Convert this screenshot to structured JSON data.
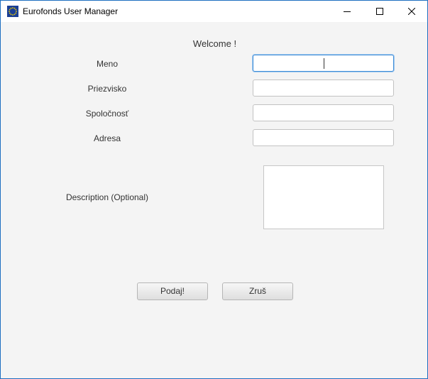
{
  "window": {
    "title": "Eurofonds User Manager",
    "icon": "eu-flag-icon",
    "controls": [
      "minimize-icon",
      "maximize-icon",
      "close-icon"
    ]
  },
  "form": {
    "welcome": "Welcome !",
    "fields": [
      {
        "label": "Meno",
        "value": "",
        "focused": true
      },
      {
        "label": "Priezvisko",
        "value": ""
      },
      {
        "label": "Spoločnosť",
        "value": ""
      },
      {
        "label": "Adresa",
        "value": ""
      }
    ],
    "description_label": "Description (Optional)",
    "description_value": ""
  },
  "buttons": {
    "submit": "Podaj!",
    "cancel": "Zruš"
  },
  "colors": {
    "window_border": "#1e6fc1",
    "focus_border": "#3c8bd6",
    "app_icon_bg": "#1b3f95",
    "app_icon_stars": "#f2d100"
  }
}
